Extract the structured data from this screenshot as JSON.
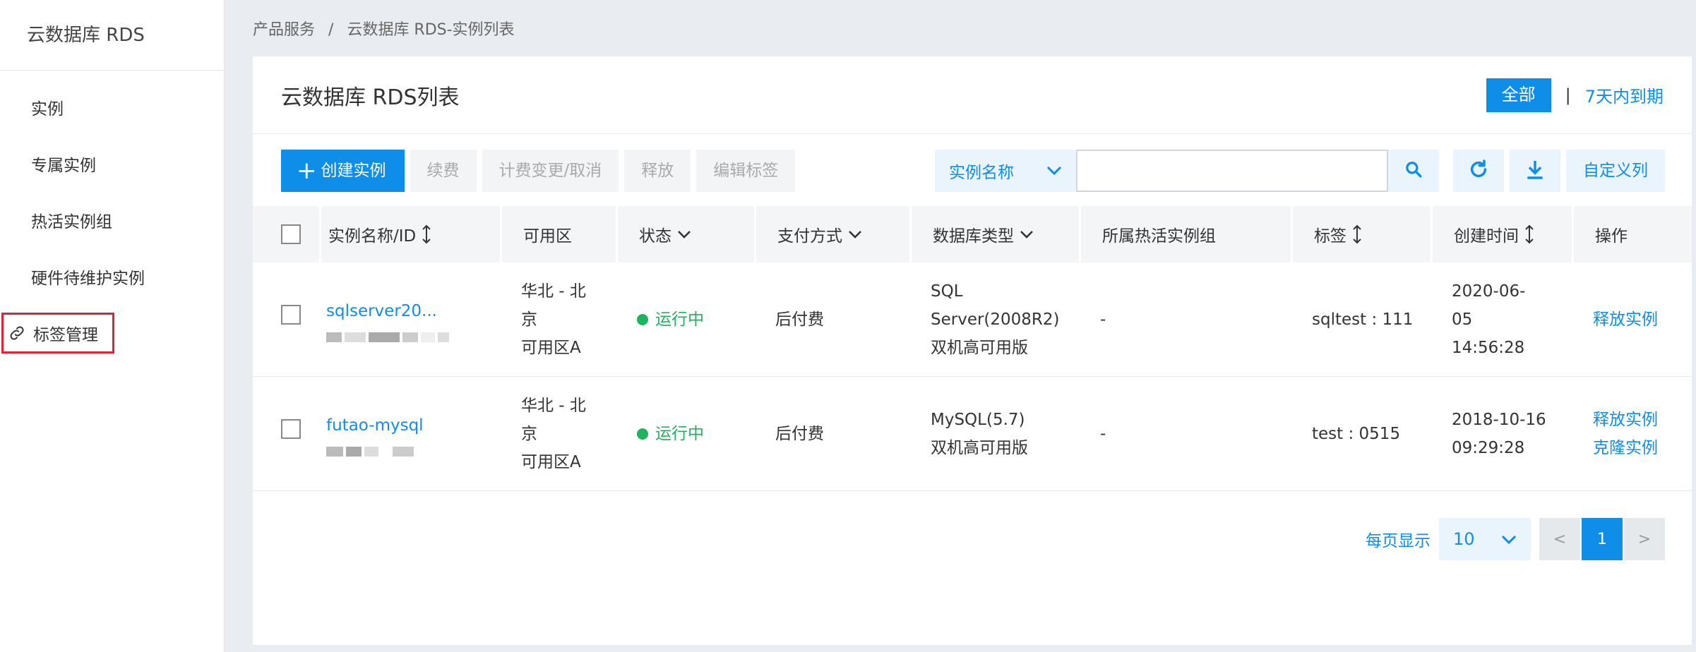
{
  "sidebar": {
    "title": "云数据库 RDS",
    "items": [
      {
        "label": "实例"
      },
      {
        "label": "专属实例"
      },
      {
        "label": "热活实例组"
      },
      {
        "label": "硬件待维护实例"
      },
      {
        "label": "标签管理"
      }
    ]
  },
  "breadcrumb": {
    "root": "产品服务",
    "sep": "/",
    "current": "云数据库 RDS-实例列表"
  },
  "card": {
    "title": "云数据库 RDS列表",
    "filter_all": "全部",
    "filter_sep": "|",
    "filter_7days": "7天内到期"
  },
  "toolbar": {
    "create_icon": "+",
    "create": "创建实例",
    "renew": "续费",
    "billing_change": "计费变更/取消",
    "release": "释放",
    "edit_tags": "编辑标签",
    "search_field": "实例名称",
    "search_value": "",
    "custom_columns": "自定义列"
  },
  "table": {
    "headers": {
      "name": "实例名称/ID",
      "zone": "可用区",
      "status": "状态",
      "pay": "支付方式",
      "db": "数据库类型",
      "group": "所属热活实例组",
      "tag": "标签",
      "time": "创建时间",
      "op": "操作"
    },
    "rows": [
      {
        "name": "sqlserver20...",
        "zone_1": "华北 - 北",
        "zone_2": "京",
        "zone_3": "可用区A",
        "status": "运行中",
        "pay": "后付费",
        "db_1": "SQL",
        "db_2": "Server(2008R2)",
        "db_3": "双机高可用版",
        "group": "-",
        "tag": "sqltest : 111",
        "time_1": "2020-06-",
        "time_2": "05",
        "time_3": "14:56:28",
        "op_1": "释放实例"
      },
      {
        "name": "futao-mysql",
        "zone_1": "华北 - 北",
        "zone_2": "京",
        "zone_3": "可用区A",
        "status": "运行中",
        "pay": "后付费",
        "db_1": "MySQL(5.7)",
        "db_2": "双机高可用版",
        "group": "-",
        "tag": "test : 0515",
        "time_1": "2018-10-16",
        "time_2": "09:29:28",
        "op_1": "释放实例",
        "op_2": "克隆实例"
      }
    ]
  },
  "pager": {
    "label": "每页显示",
    "page_size": "10",
    "prev": "<",
    "current": "1",
    "next": ">"
  },
  "colors": {
    "accent": "#0e8ee9",
    "success": "#1fb35f",
    "highlight": "#e0213a"
  }
}
